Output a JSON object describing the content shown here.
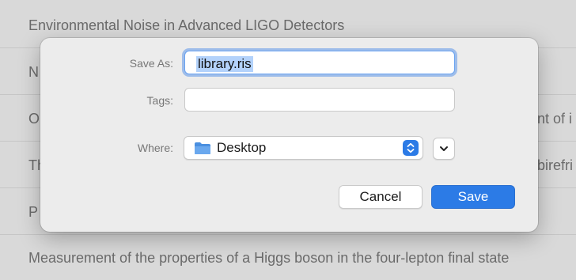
{
  "background_list": {
    "rows": [
      {
        "text": "Environmental Noise in Advanced LIGO Detectors",
        "right": ""
      },
      {
        "text": "N",
        "right": ""
      },
      {
        "text": "O",
        "right": "nt of i"
      },
      {
        "text": "Th",
        "right": "birefri"
      },
      {
        "text": "P",
        "right": ""
      },
      {
        "text": "Measurement of the properties of a Higgs boson in the four-lepton final state",
        "right": ""
      }
    ]
  },
  "dialog": {
    "save_as_label": "Save As:",
    "save_as_value": "library.ris",
    "tags_label": "Tags:",
    "tags_value": "",
    "where_label": "Where:",
    "where_value": "Desktop",
    "cancel_label": "Cancel",
    "save_label": "Save"
  },
  "colors": {
    "accent": "#2c7be6",
    "selection": "#b3d2fb",
    "folder": "#4a8fe0"
  },
  "icons": [
    "folder-icon",
    "up-down-stepper-icon",
    "chevron-down-icon"
  ]
}
